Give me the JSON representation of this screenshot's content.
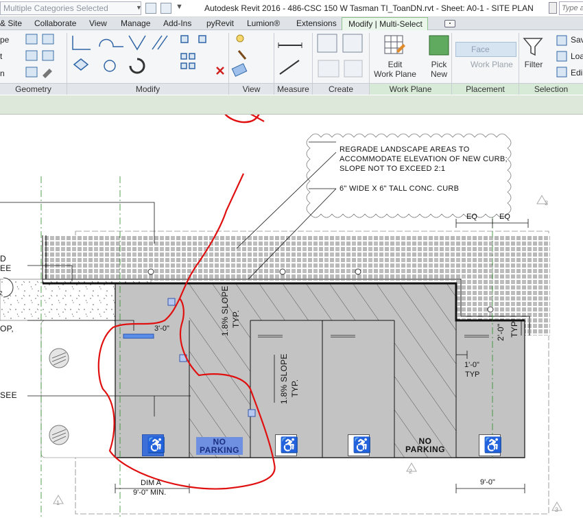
{
  "titlebar": {
    "selection_box": "Multiple Categories Selected",
    "title": "Autodesk Revit 2016 -     486-CSC 150 W Tasman TI_ToanDN.rvt - Sheet: A0-1 - SITE PLAN",
    "search_placeholder": "Type a"
  },
  "tabs": [
    {
      "label": "& Site"
    },
    {
      "label": "Collaborate"
    },
    {
      "label": "View"
    },
    {
      "label": "Manage"
    },
    {
      "label": "Add-Ins"
    },
    {
      "label": "pyRevit"
    },
    {
      "label": "Lumion®"
    },
    {
      "label": "Extensions"
    }
  ],
  "active_tab": "Modify | Multi-Select",
  "ribbon": {
    "left_labels": [
      "pe",
      "t",
      "n"
    ],
    "panels": {
      "geometry": "Geometry",
      "modify": "Modify",
      "view": "View",
      "measure": "Measure",
      "create": "Create",
      "work_plane": "Work Plane",
      "placement": "Placement",
      "selection": "Selection"
    },
    "edit_work_plane": "Edit\nWork Plane",
    "edit_work_plane_l1": "Edit",
    "edit_work_plane_l2": "Work Plane",
    "pick_new_l1": "Pick",
    "pick_new_l2": "New",
    "face": "Face",
    "work_plane_btn": "Work Plane",
    "filter": "Filter",
    "right_labels": [
      "Sav",
      "Loa",
      "Edi"
    ]
  },
  "notes": {
    "regrade_1": "REGRADE LANDSCAPE AREAS TO",
    "regrade_2": "ACCOMMODATE ELEVATION OF NEW CURB;",
    "regrade_3": "SLOPE NOT TO EXCEED 2:1",
    "curb": "6\" WIDE X 6\" TALL CONC. CURB",
    "left_d": "D",
    "left_ee": "EE",
    "left_op": "OP,",
    "left_see": "SEE"
  },
  "dims": {
    "eq1": "EQ",
    "eq2": "EQ",
    "three_ft": "3'-0\"",
    "two_ft": "2'-0\"",
    "typ_vert": "TYP.",
    "one_ft": "1'-0\"",
    "typ": "TYP",
    "nine_ft": "9'-0\"",
    "dim_a": "DIM A",
    "nine_min": "9'-0\" MIN."
  },
  "slopes": {
    "s1": "1.8% SLOPE",
    "s1_typ": "TYP.",
    "s2": "1.8% SLOPE",
    "s2_typ": "TYP."
  },
  "stalls": {
    "no_parking_1a": "NO",
    "no_parking_1b": "PARKING",
    "no_parking_2a": "NO",
    "no_parking_2b": "PARKING"
  },
  "markers": {
    "m2": "2",
    "m3": "3",
    "m1": "1",
    "m3b": "3",
    "m2b": "2"
  },
  "colors": {
    "paving": "#c3c3c3",
    "selected": "#3c6fd8",
    "annotation": "#e01010",
    "ribbon": "#f5f6f7",
    "active_tab": "#eaf6ea"
  }
}
